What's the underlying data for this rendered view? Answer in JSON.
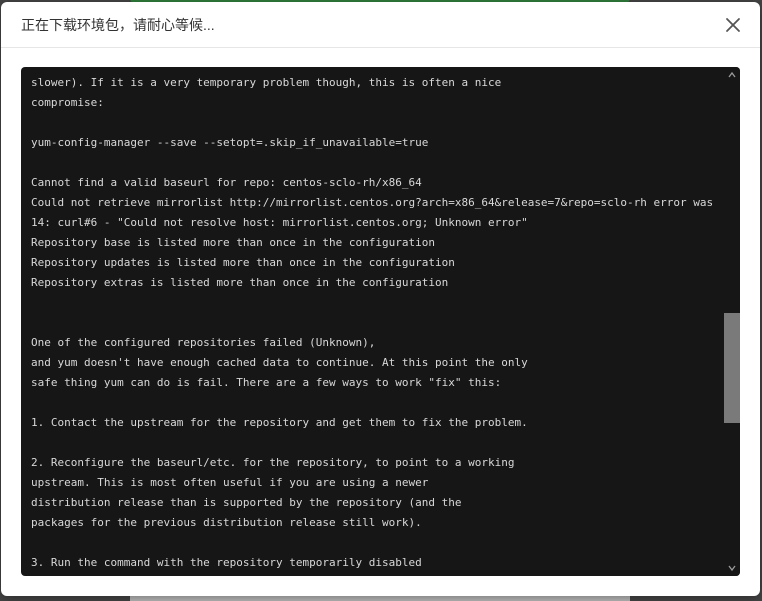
{
  "dialog": {
    "title": "正在下载环境包，请耐心等候..."
  },
  "console": {
    "lines": [
      "slower). If it is a very temporary problem though, this is often a nice",
      "compromise:",
      "",
      "yum-config-manager --save --setopt=.skip_if_unavailable=true",
      "",
      "Cannot find a valid baseurl for repo: centos-sclo-rh/x86_64",
      "Could not retrieve mirrorlist http://mirrorlist.centos.org?arch=x86_64&release=7&repo=sclo-rh error was",
      "14: curl#6 - \"Could not resolve host: mirrorlist.centos.org; Unknown error\"",
      "Repository base is listed more than once in the configuration",
      "Repository updates is listed more than once in the configuration",
      "Repository extras is listed more than once in the configuration",
      "",
      "",
      "One of the configured repositories failed (Unknown),",
      "and yum doesn't have enough cached data to continue. At this point the only",
      "safe thing yum can do is fail. There are a few ways to work \"fix\" this:",
      "",
      "1. Contact the upstream for the repository and get them to fix the problem.",
      "",
      "2. Reconfigure the baseurl/etc. for the repository, to point to a working",
      "upstream. This is most often useful if you are using a newer",
      "distribution release than is supported by the repository (and the",
      "packages for the previous distribution release still work).",
      "",
      "3. Run the command with the repository temporarily disabled"
    ]
  },
  "icons": {
    "close": "close-icon",
    "scroll_up": "chevron-up-icon",
    "scroll_down": "chevron-down-icon"
  },
  "colors": {
    "console_bg": "#161616",
    "console_text": "#d8d8d8",
    "scroll_thumb": "#7a7a7a"
  }
}
